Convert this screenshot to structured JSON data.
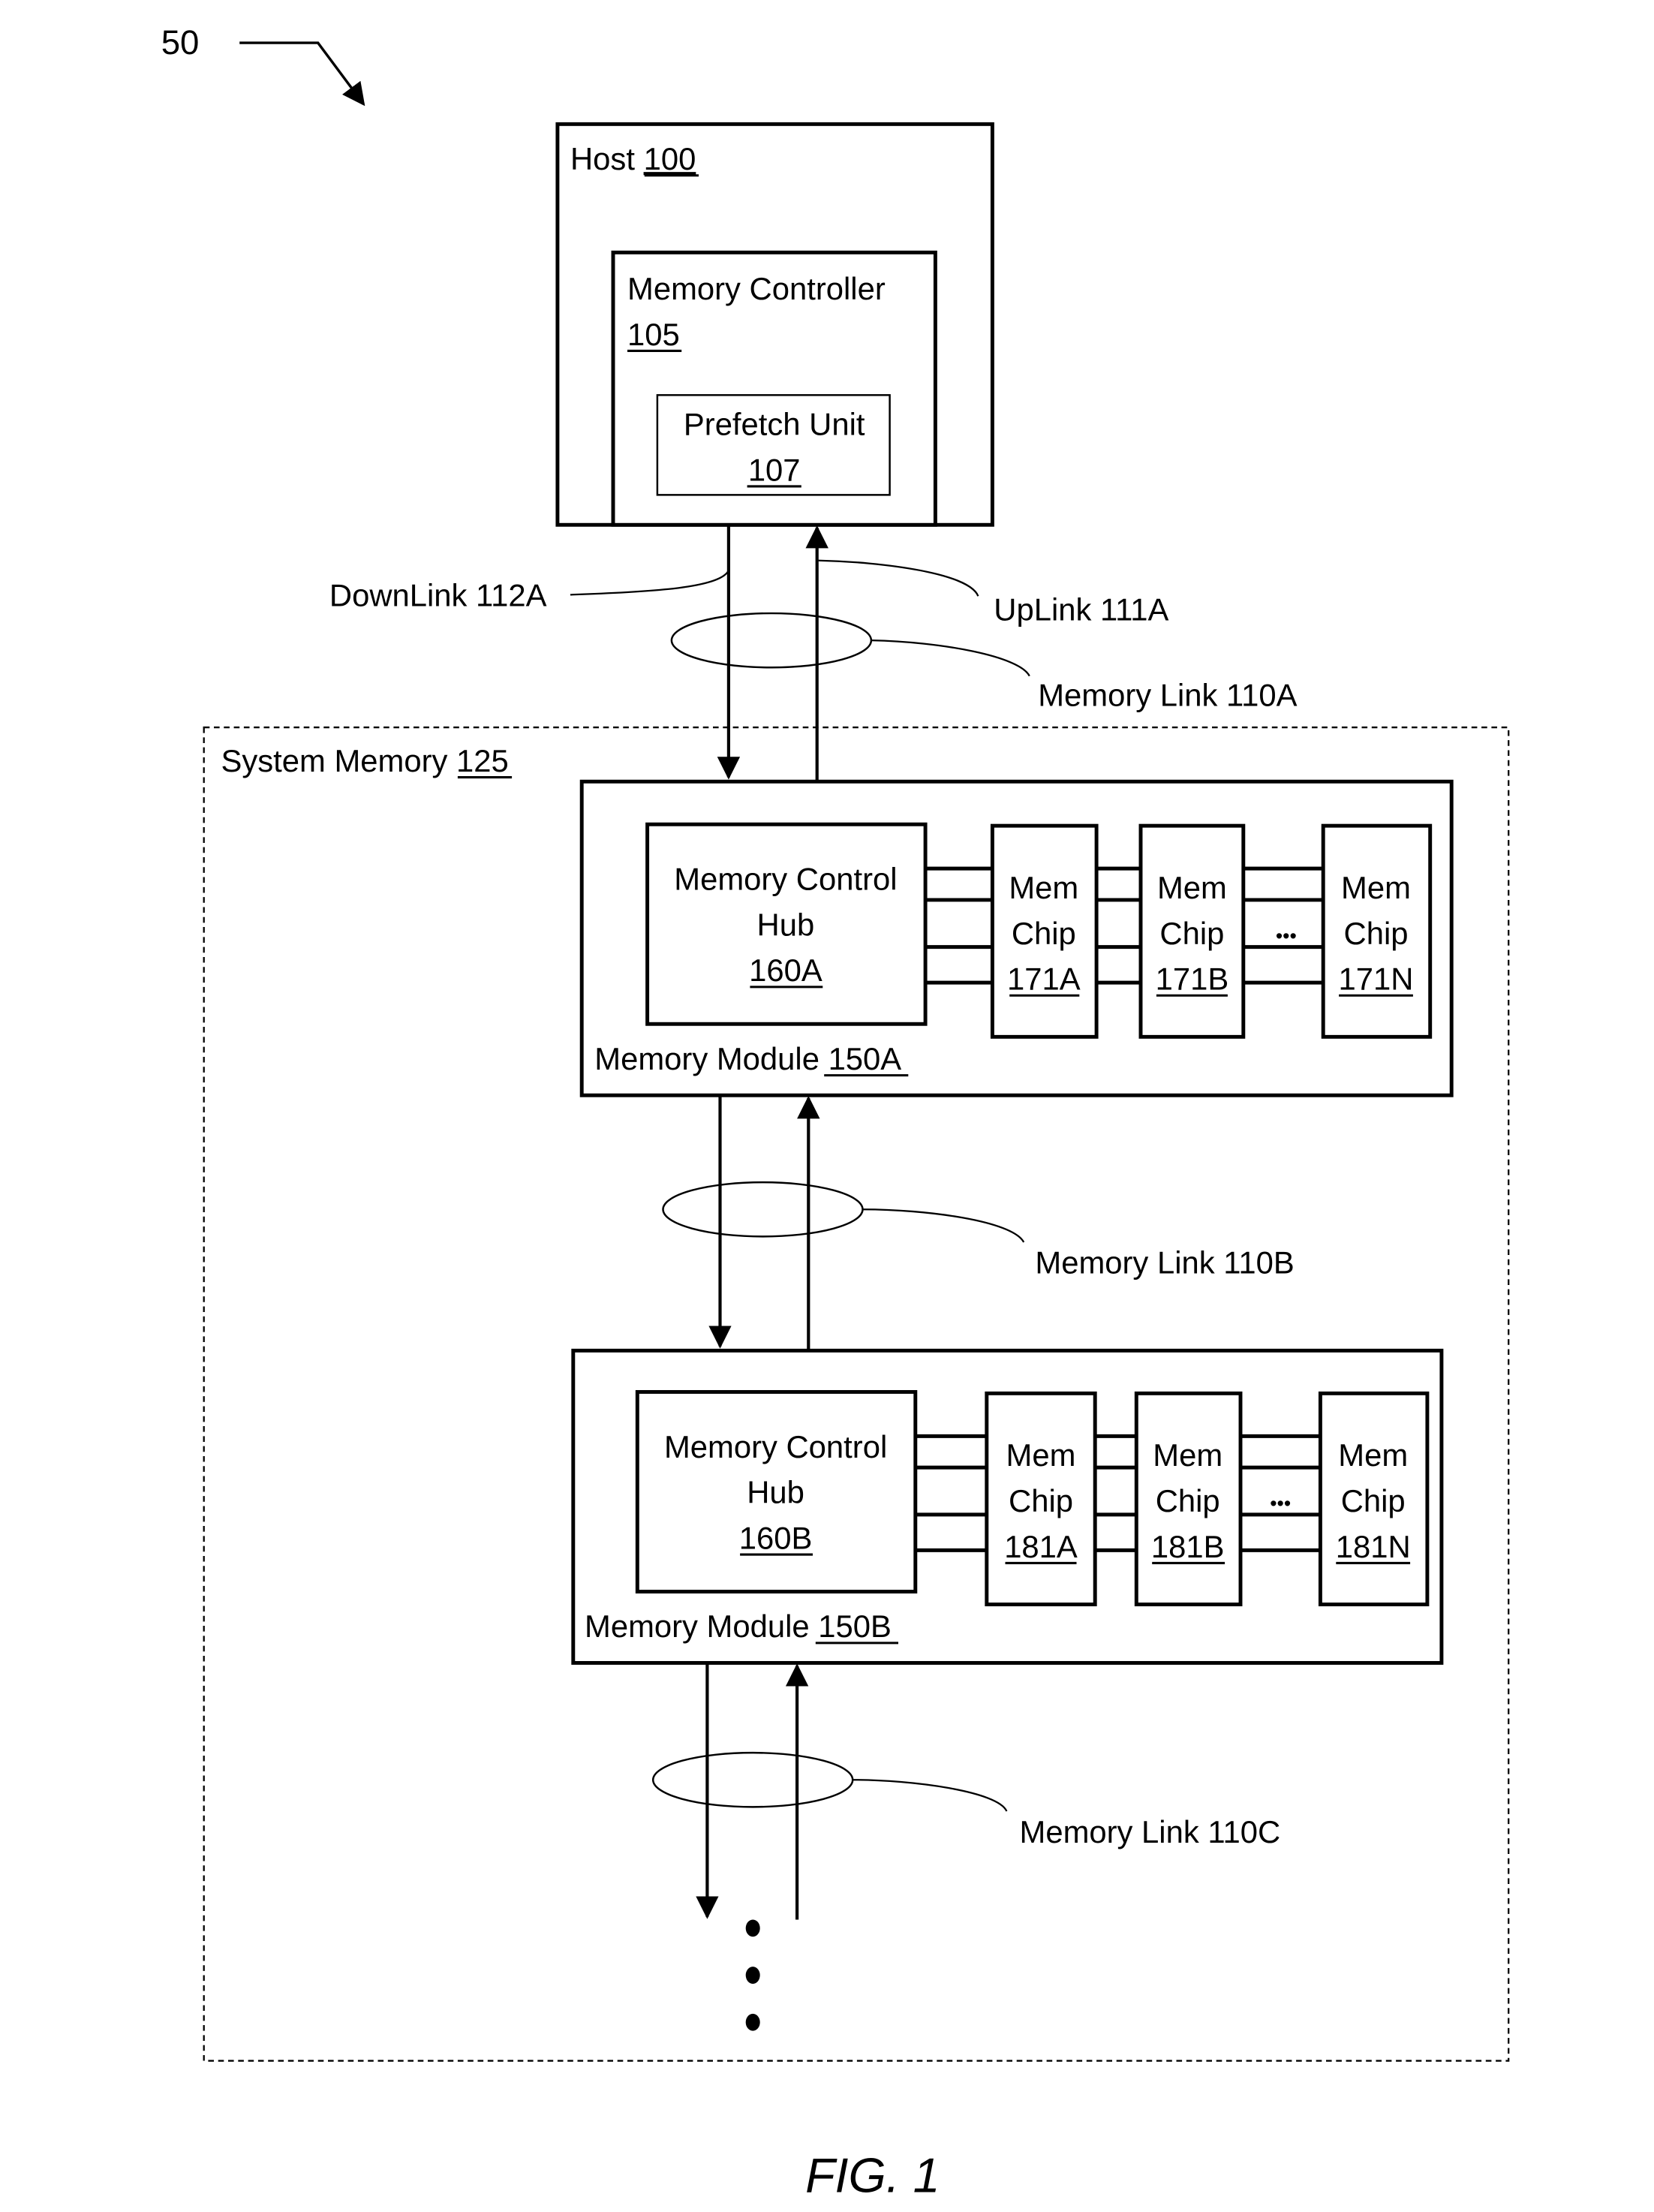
{
  "figure": {
    "reference_numeral": "50",
    "caption": "FIG. 1"
  },
  "host": {
    "label": "Host",
    "number": "100",
    "memory_controller": {
      "label": "Memory Controller",
      "number": "105",
      "prefetch_unit": {
        "label": "Prefetch Unit",
        "number": "107"
      }
    }
  },
  "links": {
    "downlink": "DownLink 112A",
    "uplink": "UpLink 111A",
    "memory_link_a": "Memory Link 110A",
    "memory_link_b": "Memory Link 110B",
    "memory_link_c": "Memory Link 110C"
  },
  "system_memory": {
    "label": "System Memory",
    "number": "125"
  },
  "modules": [
    {
      "label": "Memory Module",
      "number": "150A",
      "hub": {
        "line1": "Memory Control",
        "line2": "Hub",
        "number": "160A"
      },
      "chips": [
        {
          "line1": "Mem",
          "line2": "Chip",
          "number": "171A"
        },
        {
          "line1": "Mem",
          "line2": "Chip",
          "number": "171B"
        },
        {
          "line1": "Mem",
          "line2": "Chip",
          "number": "171N"
        }
      ],
      "ellipsis": "•••"
    },
    {
      "label": "Memory Module",
      "number": "150B",
      "hub": {
        "line1": "Memory Control",
        "line2": "Hub",
        "number": "160B"
      },
      "chips": [
        {
          "line1": "Mem",
          "line2": "Chip",
          "number": "181A"
        },
        {
          "line1": "Mem",
          "line2": "Chip",
          "number": "181B"
        },
        {
          "line1": "Mem",
          "line2": "Chip",
          "number": "181N"
        }
      ],
      "ellipsis": "•••"
    }
  ]
}
